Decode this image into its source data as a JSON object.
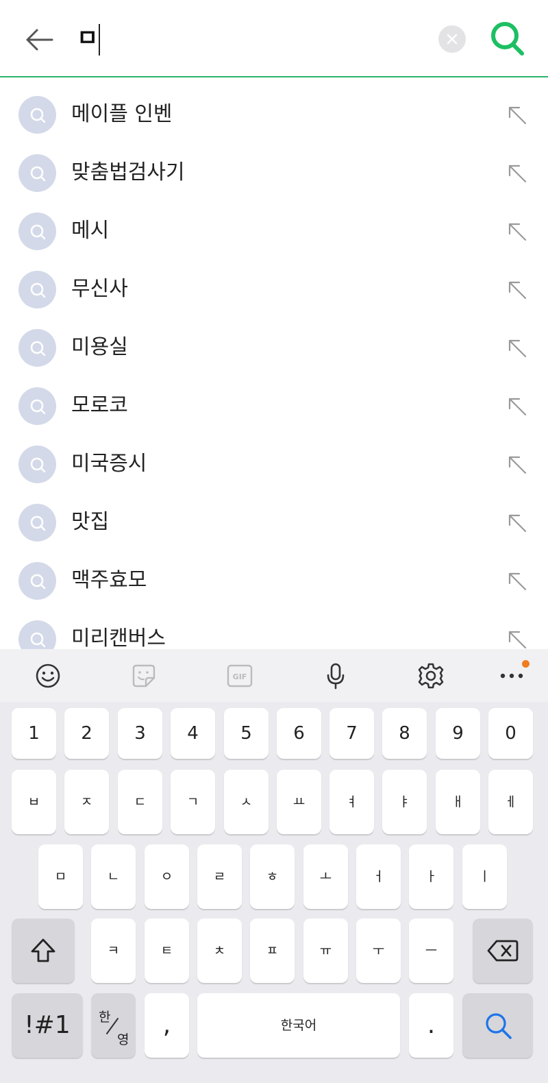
{
  "search": {
    "query": "ㅁ",
    "accent_color": "#2db36b"
  },
  "suggestions": [
    {
      "text": "메이플 인벤"
    },
    {
      "text": "맞춤법검사기"
    },
    {
      "text": "메시"
    },
    {
      "text": "무신사"
    },
    {
      "text": "미용실"
    },
    {
      "text": "모로코"
    },
    {
      "text": "미국증시"
    },
    {
      "text": "맛집"
    },
    {
      "text": "맥주효모"
    },
    {
      "text": "미리캔버스"
    }
  ],
  "toolbar": {
    "icons": [
      "emoji-icon",
      "sticker-icon",
      "gif-icon",
      "microphone-icon",
      "gear-icon",
      "more-icon"
    ],
    "gif_label": "GIF",
    "notification_color": "#f07c1f"
  },
  "keyboard": {
    "row_numbers": [
      "1",
      "2",
      "3",
      "4",
      "5",
      "6",
      "7",
      "8",
      "9",
      "0"
    ],
    "row1": [
      "ㅂ",
      "ㅈ",
      "ㄷ",
      "ㄱ",
      "ㅅ",
      "ㅛ",
      "ㅕ",
      "ㅑ",
      "ㅐ",
      "ㅔ"
    ],
    "row2": [
      "ㅁ",
      "ㄴ",
      "ㅇ",
      "ㄹ",
      "ㅎ",
      "ㅗ",
      "ㅓ",
      "ㅏ",
      "ㅣ"
    ],
    "row3": [
      "ㅋ",
      "ㅌ",
      "ㅊ",
      "ㅍ",
      "ㅠ",
      "ㅜ",
      "ㅡ"
    ],
    "symbols_label": "!#1",
    "han_label": "한",
    "yeong_label": "영",
    "comma_label": ",",
    "space_label": "한국어",
    "period_label": "."
  }
}
